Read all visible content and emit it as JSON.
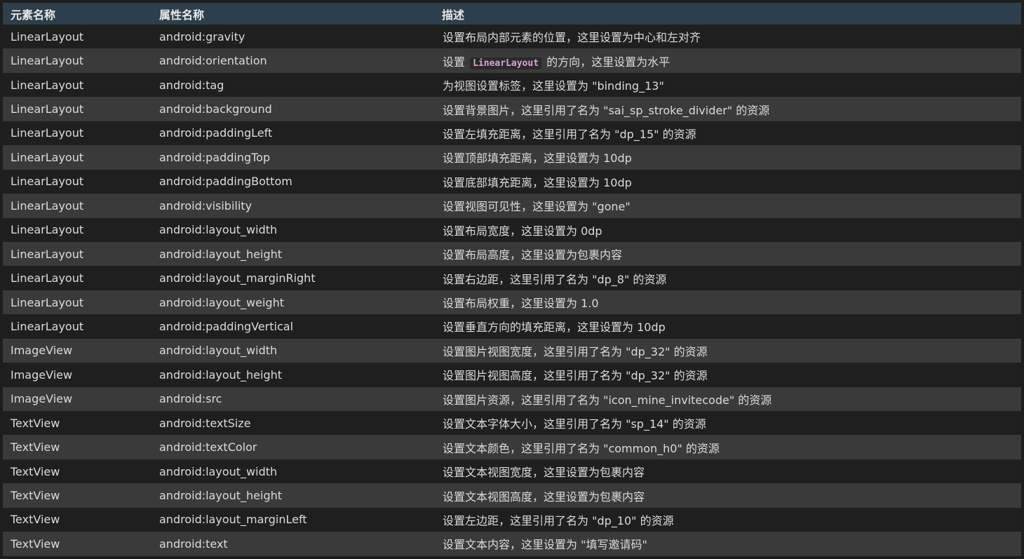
{
  "table": {
    "headers": [
      "元素名称",
      "属性名称",
      "描述"
    ],
    "rows": [
      {
        "element": "LinearLayout",
        "attribute": "android:gravity",
        "description": "设置布局内部元素的位置，这里设置为中心和左对齐"
      },
      {
        "element": "LinearLayout",
        "attribute": "android:orientation",
        "description_pre": "设置",
        "description_code": "LinearLayout",
        "description_post": "的方向，这里设置为水平"
      },
      {
        "element": "LinearLayout",
        "attribute": "android:tag",
        "description": "为视图设置标签，这里设置为 \"binding_13\""
      },
      {
        "element": "LinearLayout",
        "attribute": "android:background",
        "description": "设置背景图片，这里引用了名为 \"sai_sp_stroke_divider\" 的资源"
      },
      {
        "element": "LinearLayout",
        "attribute": "android:paddingLeft",
        "description": "设置左填充距离，这里引用了名为 \"dp_15\" 的资源"
      },
      {
        "element": "LinearLayout",
        "attribute": "android:paddingTop",
        "description": "设置顶部填充距离，这里设置为 10dp"
      },
      {
        "element": "LinearLayout",
        "attribute": "android:paddingBottom",
        "description": "设置底部填充距离，这里设置为 10dp"
      },
      {
        "element": "LinearLayout",
        "attribute": "android:visibility",
        "description": "设置视图可见性，这里设置为 \"gone\""
      },
      {
        "element": "LinearLayout",
        "attribute": "android:layout_width",
        "description": "设置布局宽度，这里设置为 0dp"
      },
      {
        "element": "LinearLayout",
        "attribute": "android:layout_height",
        "description": "设置布局高度，这里设置为包裹内容"
      },
      {
        "element": "LinearLayout",
        "attribute": "android:layout_marginRight",
        "description": "设置右边距，这里引用了名为 \"dp_8\" 的资源"
      },
      {
        "element": "LinearLayout",
        "attribute": "android:layout_weight",
        "description": "设置布局权重，这里设置为 1.0"
      },
      {
        "element": "LinearLayout",
        "attribute": "android:paddingVertical",
        "description": "设置垂直方向的填充距离，这里设置为 10dp"
      },
      {
        "element": "ImageView",
        "attribute": "android:layout_width",
        "description": "设置图片视图宽度，这里引用了名为 \"dp_32\" 的资源"
      },
      {
        "element": "ImageView",
        "attribute": "android:layout_height",
        "description": "设置图片视图高度，这里引用了名为 \"dp_32\" 的资源"
      },
      {
        "element": "ImageView",
        "attribute": "android:src",
        "description": "设置图片资源，这里引用了名为 \"icon_mine_invitecode\" 的资源"
      },
      {
        "element": "TextView",
        "attribute": "android:textSize",
        "description": "设置文本字体大小，这里引用了名为 \"sp_14\" 的资源"
      },
      {
        "element": "TextView",
        "attribute": "android:textColor",
        "description": "设置文本颜色，这里引用了名为 \"common_h0\" 的资源"
      },
      {
        "element": "TextView",
        "attribute": "android:layout_width",
        "description": "设置文本视图宽度，这里设置为包裹内容"
      },
      {
        "element": "TextView",
        "attribute": "android:layout_height",
        "description": "设置文本视图高度，这里设置为包裹内容"
      },
      {
        "element": "TextView",
        "attribute": "android:layout_marginLeft",
        "description": "设置左边距，这里引用了名为 \"dp_10\" 的资源"
      },
      {
        "element": "TextView",
        "attribute": "android:text",
        "description": "设置文本内容，这里设置为 \"填写邀请码\""
      }
    ]
  },
  "colors": {
    "header_bg": "#2d3f4d",
    "row_odd_bg": "#1f1f1f",
    "row_even_bg": "#3a3a3a",
    "inline_code_text": "#d7a3d6"
  }
}
